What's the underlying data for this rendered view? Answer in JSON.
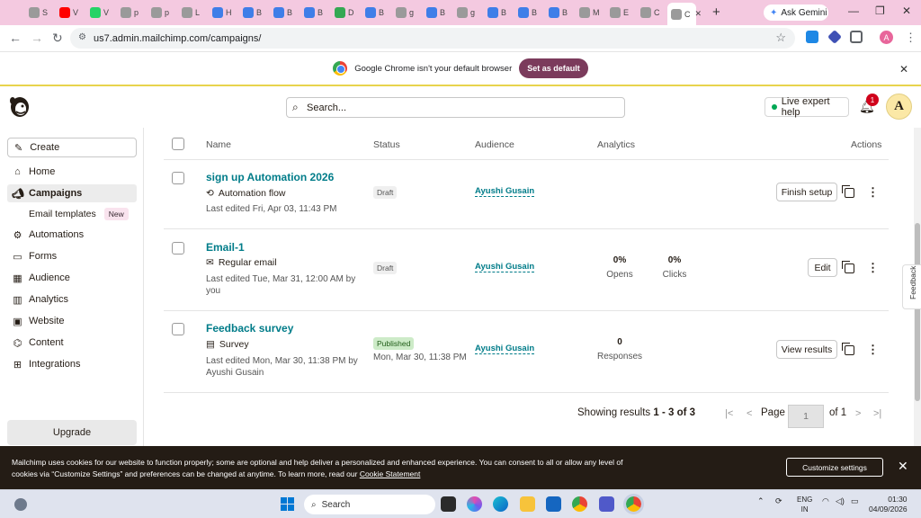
{
  "browser": {
    "tabs": [
      {
        "label": "S",
        "color": "#9a9a9a"
      },
      {
        "label": "V",
        "color": "#ff0000"
      },
      {
        "label": "V",
        "color": "#25d366"
      },
      {
        "label": "p",
        "color": "#9a9a9a"
      },
      {
        "label": "p",
        "color": "#9a9a9a"
      },
      {
        "label": "L",
        "color": "#9a9a9a"
      },
      {
        "label": "H",
        "color": "#3f7ee8"
      },
      {
        "label": "B",
        "color": "#3f7ee8"
      },
      {
        "label": "B",
        "color": "#3f7ee8"
      },
      {
        "label": "B",
        "color": "#3f7ee8"
      },
      {
        "label": "D",
        "color": "#34a853"
      },
      {
        "label": "B",
        "color": "#3f7ee8"
      },
      {
        "label": "g",
        "color": "#9a9a9a"
      },
      {
        "label": "B",
        "color": "#3f7ee8"
      },
      {
        "label": "g",
        "color": "#9a9a9a"
      },
      {
        "label": "B",
        "color": "#3f7ee8"
      },
      {
        "label": "B",
        "color": "#3f7ee8"
      },
      {
        "label": "B",
        "color": "#3f7ee8"
      },
      {
        "label": "M",
        "color": "#9a9a9a"
      },
      {
        "label": "E",
        "color": "#9a9a9a"
      },
      {
        "label": "C",
        "color": "#9a9a9a"
      },
      {
        "label": "C",
        "color": "#9a9a9a"
      }
    ],
    "gemini_label": "Ask Gemini",
    "url": "us7.admin.mailchimp.com/campaigns/",
    "profile_initial": "A",
    "infobar_text": "Google Chrome isn't your default browser",
    "infobar_button": "Set as default"
  },
  "header": {
    "search_placeholder": "Search...",
    "live_help": "Live expert help",
    "notification_count": "1",
    "avatar_initial": "A"
  },
  "sidebar": {
    "create": "Create",
    "items": [
      {
        "label": "Home",
        "icon": "home-icon"
      },
      {
        "label": "Campaigns",
        "icon": "megaphone-icon"
      },
      {
        "label": "Automations",
        "icon": "automation-icon"
      },
      {
        "label": "Forms",
        "icon": "forms-icon"
      },
      {
        "label": "Audience",
        "icon": "audience-icon"
      },
      {
        "label": "Analytics",
        "icon": "analytics-icon"
      },
      {
        "label": "Website",
        "icon": "website-icon"
      },
      {
        "label": "Content",
        "icon": "content-icon"
      },
      {
        "label": "Integrations",
        "icon": "integrations-icon"
      }
    ],
    "sub_email_templates": "Email templates",
    "sub_new_badge": "New",
    "upgrade": "Upgrade"
  },
  "table": {
    "headers": {
      "name": "Name",
      "status": "Status",
      "audience": "Audience",
      "analytics": "Analytics",
      "actions": "Actions"
    },
    "rows": [
      {
        "name": "sign up Automation 2026",
        "type": "Automation flow",
        "edited": "Last edited Fri, Apr 03, 11:43 PM",
        "status": "Draft",
        "status_date": "",
        "audience": "Ayushi Gusain",
        "metrics": [],
        "action": "Finish setup"
      },
      {
        "name": "Email-1",
        "type": "Regular email",
        "edited": "Last edited Tue, Mar 31, 12:00 AM by you",
        "status": "Draft",
        "status_date": "",
        "audience": "Ayushi Gusain",
        "metrics": [
          {
            "value": "0%",
            "label": "Opens"
          },
          {
            "value": "0%",
            "label": "Clicks"
          }
        ],
        "action": "Edit"
      },
      {
        "name": "Feedback survey",
        "type": "Survey",
        "edited": "Last edited Mon, Mar 30, 11:38 PM by Ayushi Gusain",
        "status": "Published",
        "status_date": "Mon, Mar 30, 11:38 PM",
        "audience": "Ayushi Gusain",
        "metrics": [
          {
            "value": "0",
            "label": "Responses"
          }
        ],
        "action": "View results"
      }
    ],
    "pagination": {
      "showing_prefix": "Showing results ",
      "showing_range": "1 - 3 of 3",
      "page_label": "Page",
      "page_value": "1",
      "of_label": "of 1"
    }
  },
  "feedback_tab": "Feedback",
  "cookie": {
    "text": "Mailchimp uses cookies for our website to function properly; some are optional and help deliver a personalized and enhanced experience. You can consent to all or allow any level of cookies via “Customize Settings” and preferences can be changed at anytime. To learn more, read our ",
    "link": "Cookie Statement",
    "button": "Customize settings"
  },
  "taskbar": {
    "search": "Search",
    "lang": "ENG",
    "region": "IN",
    "time": "01:30",
    "date": "04/09/2026"
  }
}
